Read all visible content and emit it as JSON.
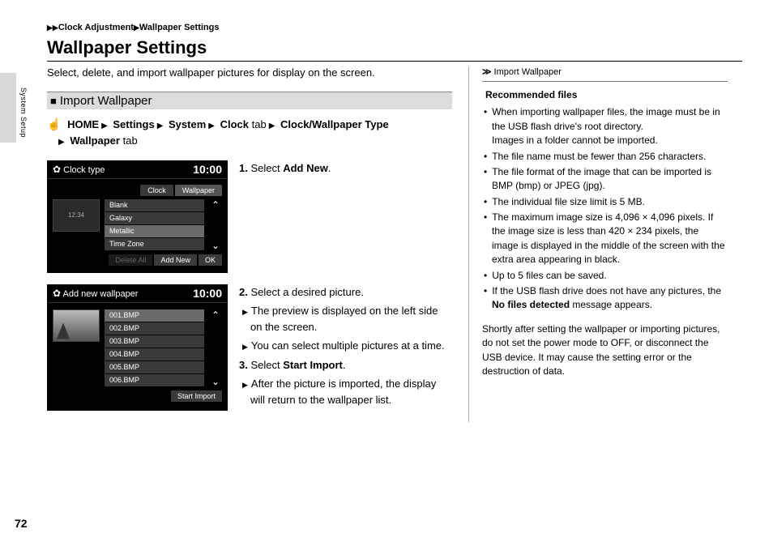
{
  "breadcrumb": {
    "a": "Clock Adjustment",
    "b": "Wallpaper Settings"
  },
  "sideLabel": "System Setup",
  "title": "Wallpaper Settings",
  "intro": "Select, delete, and import wallpaper pictures for display on the screen.",
  "section": "Import Wallpaper",
  "nav": {
    "home": "HOME",
    "settings": "Settings",
    "system": "System",
    "clockTab": "Clock",
    "clockType": "Clock/Wallpaper Type",
    "wallpaperTab": "Wallpaper",
    "tabWord": "tab"
  },
  "shot1": {
    "title": "Clock type",
    "time": "10:00",
    "tabClock": "Clock",
    "tabWallpaper": "Wallpaper",
    "preview": "12:34",
    "opts": [
      "Blank",
      "Galaxy",
      "Metallic",
      "Time Zone"
    ],
    "deleteAll": "Delete All",
    "addNew": "Add New",
    "ok": "OK"
  },
  "shot2": {
    "title": "Add new wallpaper",
    "time": "10:00",
    "files": [
      "001.BMP",
      "002.BMP",
      "003.BMP",
      "004.BMP",
      "005.BMP",
      "006.BMP"
    ],
    "startImport": "Start Import"
  },
  "steps": {
    "s1a": "Select ",
    "s1b": "Add New",
    "s2": "Select a desired picture.",
    "s2a": "The preview is displayed on the left side on the screen.",
    "s2b": "You can select multiple pictures at a time.",
    "s3a": "Select ",
    "s3b": "Start Import",
    "s3c": "After the picture is imported, the display will return to the wallpaper list."
  },
  "right": {
    "refTitle": "Import Wallpaper",
    "recHead": "Recommended files",
    "b1a": "When importing wallpaper files, the image must be in the USB flash drive's root directory.",
    "b1b": "Images in a folder cannot be imported.",
    "b2": "The file name must be fewer than 256 characters.",
    "b3": "The file format of the image that can be imported is BMP (bmp) or JPEG (jpg).",
    "b4": "The individual file size limit is 5 MB.",
    "b5": "The maximum image size is 4,096 × 4,096 pixels. If the image size is less than 420 × 234 pixels, the image is displayed in the middle of the screen with the extra area appearing in black.",
    "b6": "Up to 5 files can be saved.",
    "b7a": "If the USB flash drive does not have any pictures, the ",
    "b7b": "No files detected",
    "b7c": " message appears.",
    "note": "Shortly after setting the wallpaper or importing pictures, do not set the power mode to OFF, or disconnect the USB device. It may cause the setting error or the destruction of data."
  },
  "pageNum": "72"
}
